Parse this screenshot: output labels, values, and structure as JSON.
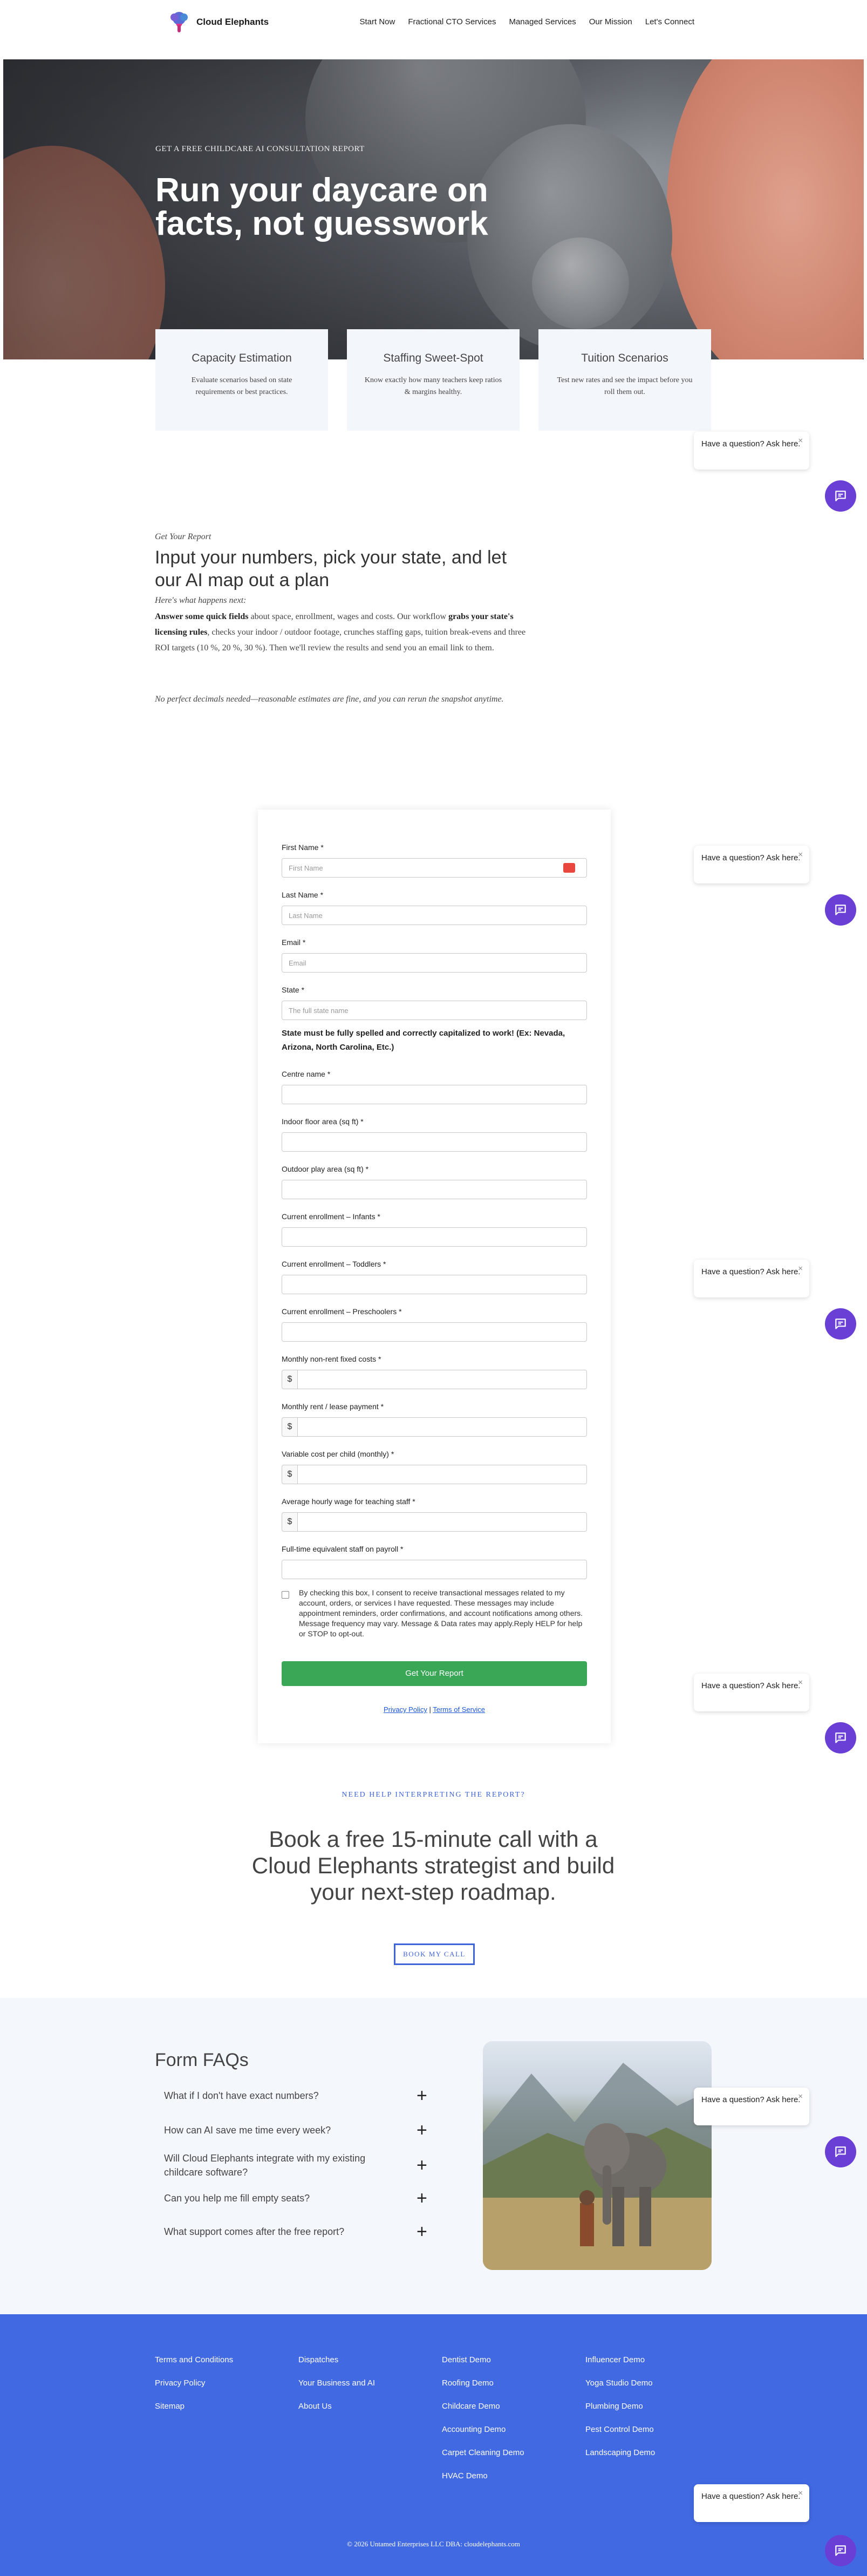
{
  "brand": {
    "name": "Cloud Elephants"
  },
  "nav": {
    "items": [
      "Start Now",
      "Fractional CTO Services",
      "Managed Services",
      "Our Mission",
      "Let's Connect"
    ]
  },
  "hero": {
    "kicker": "GET A FREE CHILDCARE AI CONSULTATION REPORT",
    "title": "Run your daycare on facts, not guesswork"
  },
  "cards": [
    {
      "title": "Capacity Estimation",
      "text": "Evaluate scenarios based on state requirements or best practices."
    },
    {
      "title": "Staffing Sweet-Spot",
      "text": "Know exactly how many teachers keep ratios & margins healthy."
    },
    {
      "title": "Tuition Scenarios",
      "text": "Test new rates and see the impact before you roll them out."
    }
  ],
  "chat": {
    "prompt": "Have a question? Ask here.",
    "close": "×"
  },
  "intro": {
    "eyebrow": "Get Your Report",
    "title": "Input your numbers, pick your state, and let our AI map out a plan",
    "sub": "Here's what happens next:",
    "body_lead": "Answer some quick fields",
    "body_mid": " about space, enrollment, wages and costs. Our workflow ",
    "body_bold2": "grabs your state's licensing rules",
    "body_end": ", checks your indoor / outdoor footage, crunches staffing gaps, tuition break-evens and three ROI targets (10 %, 20 %, 30 %). Then we'll review the results and send you an email link to them.",
    "note": "No perfect decimals needed—reasonable estimates are fine, and you can rerun the snapshot anytime."
  },
  "form": {
    "first_name_label": "First Name *",
    "first_name_placeholder": "First Name",
    "last_name_label": "Last Name *",
    "last_name_placeholder": "Last Name",
    "email_label": "Email *",
    "email_placeholder": "Email",
    "state_label": "State *",
    "state_placeholder": "The full state name",
    "state_note": "State must be fully spelled and correctly capitalized to work! (Ex: Nevada, Arizona, North Carolina, Etc.)",
    "centre_label": "Centre name *",
    "indoor_label": "Indoor floor area (sq ft) *",
    "outdoor_label": "Outdoor play area (sq ft) *",
    "infants_label": "Current enrollment – Infants *",
    "toddlers_label": "Current enrollment – Toddlers *",
    "preschoolers_label": "Current enrollment – Preschoolers *",
    "fixed_costs_label": "Monthly non-rent fixed costs *",
    "rent_label": "Monthly rent / lease payment *",
    "variable_label": "Variable cost per child (monthly) *",
    "wage_label": "Average hourly wage for teaching staff *",
    "fte_label": "Full-time equivalent staff on payroll *",
    "currency": "$",
    "consent": "By checking this box, I consent to receive transactional messages related to my account, orders, or services I have requested. These messages may include appointment reminders, order confirmations, and account notifications among others. Message frequency may vary. Message & Data rates may apply.Reply HELP for help or STOP to opt-out.",
    "submit": "Get Your Report",
    "privacy": "Privacy Policy",
    "sep": " | ",
    "terms": "Terms of Service"
  },
  "cta": {
    "eyebrow": "NEED HELP INTERPRETING THE REPORT?",
    "title": "Book a free 15-minute call with a Cloud Elephants strategist and build your next-step roadmap.",
    "button": "BOOK MY CALL"
  },
  "faq": {
    "title": "Form FAQs",
    "items": [
      "What if I don't have exact numbers?",
      "How can AI save me time every week?",
      "Will Cloud Elephants integrate with my existing childcare software?",
      "Can you help me fill empty seats?",
      "What support comes after the free report?"
    ],
    "plus": "+"
  },
  "footer": {
    "col1": [
      "Terms and Conditions",
      "Privacy Policy",
      "Sitemap"
    ],
    "col2": [
      "Dispatches",
      "Your Business and AI",
      "About Us"
    ],
    "col3": [
      "Dentist Demo",
      "Roofing Demo",
      "Childcare Demo",
      "Accounting Demo",
      "Carpet Cleaning Demo",
      "HVAC Demo"
    ],
    "col4": [
      "Influencer Demo",
      "Yoga Studio Demo",
      "Plumbing Demo",
      "Pest Control Demo",
      "Landscaping Demo"
    ],
    "copyright": "© 2026 Untamed Enterprises LLC DBA: cloudelephants.com"
  },
  "colors": {
    "accent": "#4169e1",
    "chat": "#6a3fd6",
    "submit": "#3aa757"
  }
}
